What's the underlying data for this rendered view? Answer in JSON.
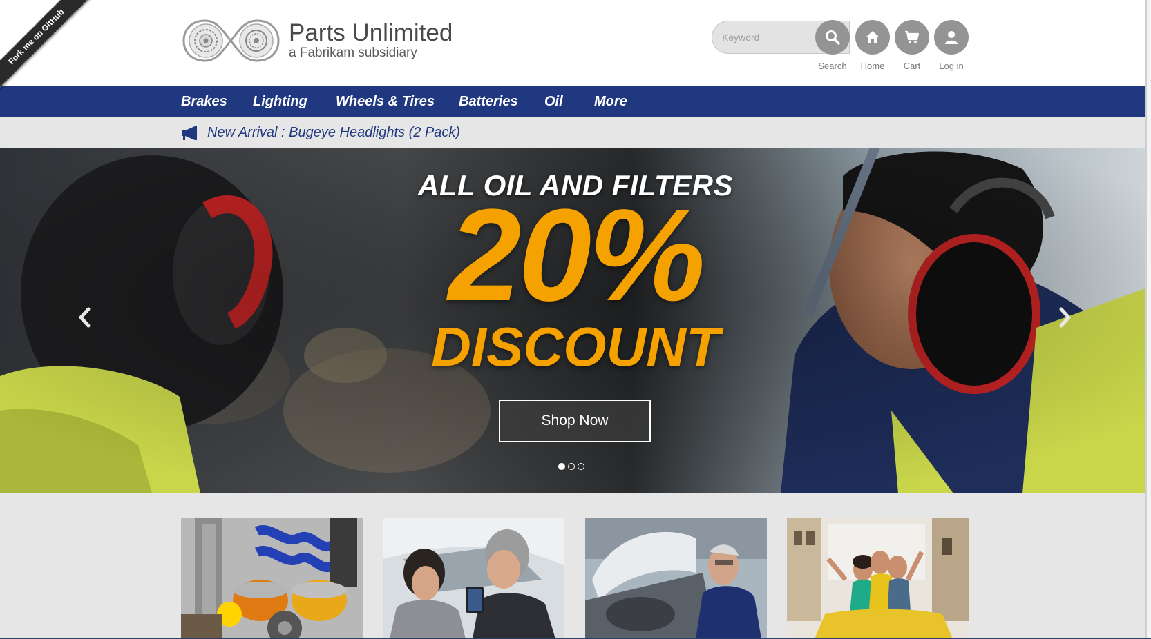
{
  "ribbon": {
    "label": "Fork me on GitHub"
  },
  "brand": {
    "title": "Parts Unlimited",
    "subtitle": "a Fabrikam subsidiary"
  },
  "search": {
    "placeholder": "Keyword",
    "value": ""
  },
  "header_actions": [
    {
      "label": "Search",
      "icon": "search-icon"
    },
    {
      "label": "Home",
      "icon": "home-icon"
    },
    {
      "label": "Cart",
      "icon": "cart-icon"
    },
    {
      "label": "Log in",
      "icon": "user-icon"
    }
  ],
  "nav": {
    "items": [
      {
        "label": "Brakes"
      },
      {
        "label": "Lighting"
      },
      {
        "label": "Wheels & Tires"
      },
      {
        "label": "Batteries"
      },
      {
        "label": "Oil"
      },
      {
        "label": "More"
      }
    ]
  },
  "announcement": {
    "icon": "megaphone-icon",
    "text": "New Arrival : Bugeye Headlights (2 Pack)"
  },
  "hero": {
    "heading": "ALL OIL AND FILTERS",
    "big_text": "20%",
    "discount_text": "DISCOUNT",
    "cta_label": "Shop Now",
    "slide_count": 3,
    "active_slide": 1,
    "prev_icon": "chevron-left-icon",
    "next_icon": "chevron-right-icon"
  },
  "tiles": [
    {
      "image": "auto-parts-photo"
    },
    {
      "image": "car-salesperson-photo"
    },
    {
      "image": "mechanic-photo"
    },
    {
      "image": "convertible-friends-photo"
    }
  ],
  "colors": {
    "nav_bg": "#1f3880",
    "accent_orange": "#f5a100",
    "icon_button_gray": "#949494",
    "page_bg": "#e6e6e6"
  }
}
